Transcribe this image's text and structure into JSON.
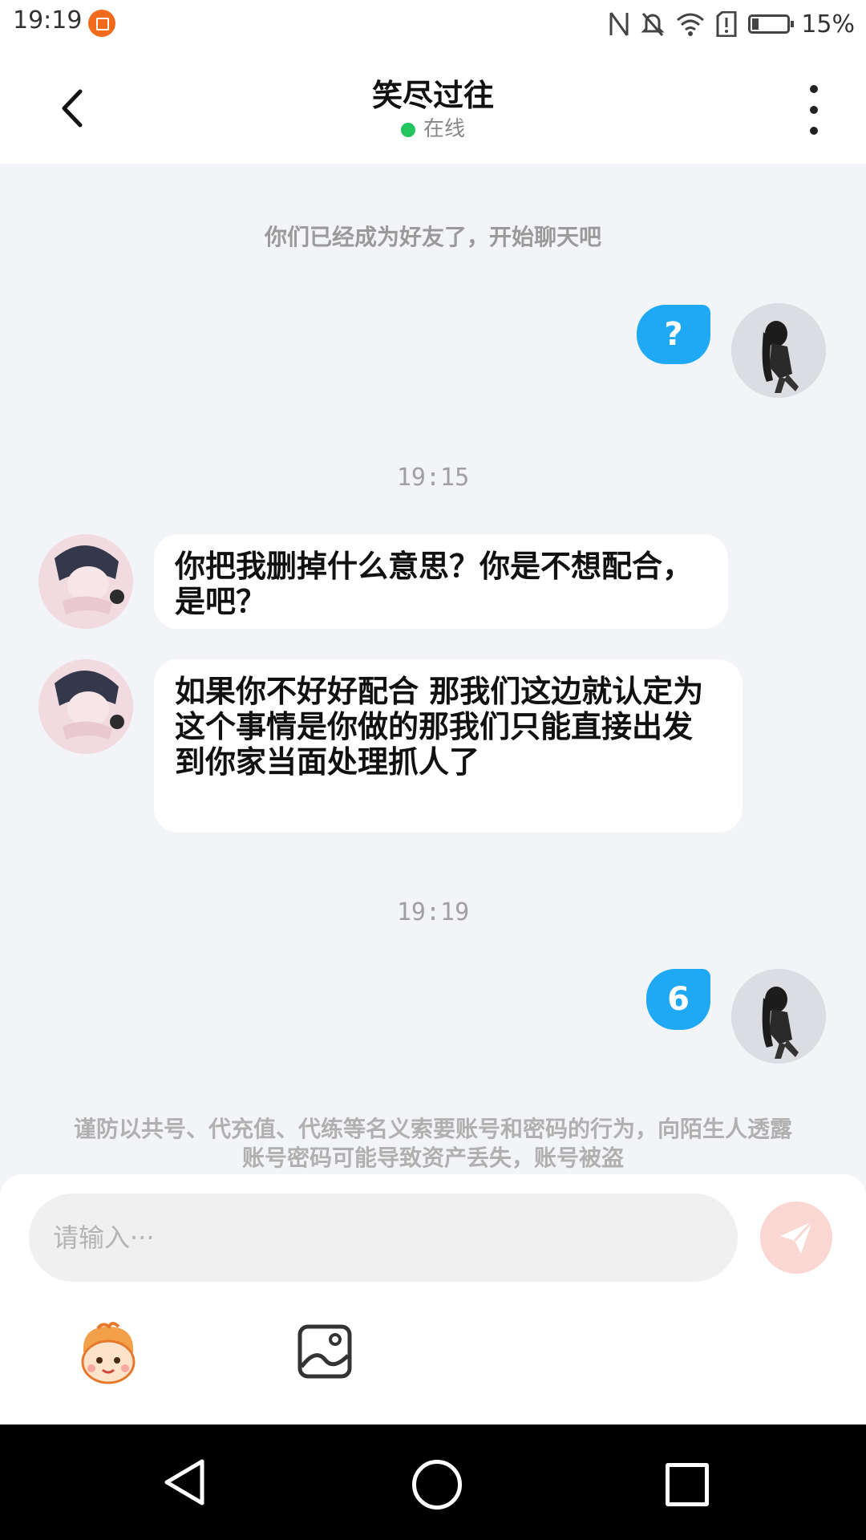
{
  "status_bar": {
    "time": "19:19",
    "battery": "15%"
  },
  "header": {
    "title": "笑尽过往",
    "status": "在线",
    "online_color": "#22c55e"
  },
  "chat": {
    "system_note": "你们已经成为好友了，开始聊天吧",
    "messages": [
      {
        "side": "out",
        "text": "?"
      },
      {
        "type": "time",
        "text": "19:15"
      },
      {
        "side": "in",
        "text": "你把我删掉什么意思？你是不想配合，是吧？"
      },
      {
        "side": "in",
        "text": "如果你不好好配合 那我们这边就认定为这个事情是你做的那我们只能直接出发到你家当面处理抓人了"
      },
      {
        "type": "time",
        "text": "19:19"
      },
      {
        "side": "out",
        "text": "6"
      }
    ],
    "warning": "谨防以共号、代充值、代练等名义索要账号和密码的行为，向陌生人透露账号密码可能导致资产丢失，账号被盗"
  },
  "composer": {
    "placeholder": "请输入···"
  },
  "colors": {
    "outgoing_bubble": "#1fa9f5",
    "send_button": "#fbd7d3"
  },
  "icons": {
    "back": "chevron-left-icon",
    "more": "more-vertical-icon",
    "send": "send-icon",
    "emoji": "emoji-mascot-icon",
    "image": "image-icon"
  }
}
